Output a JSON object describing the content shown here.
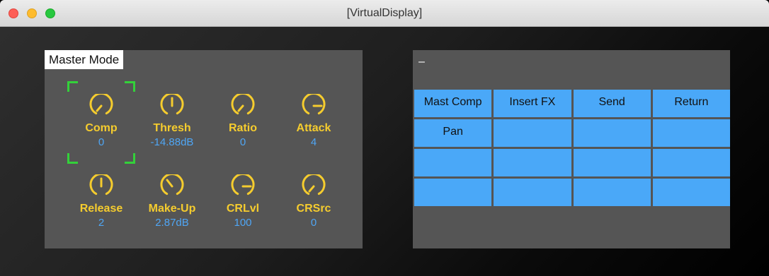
{
  "window": {
    "title": "[VirtualDisplay]"
  },
  "left_panel": {
    "title": "Master Mode",
    "knobs": [
      {
        "label": "Comp",
        "value": "0"
      },
      {
        "label": "Thresh",
        "value": "-14.88dB"
      },
      {
        "label": "Ratio",
        "value": "0"
      },
      {
        "label": "Attack",
        "value": "4"
      },
      {
        "label": "Release",
        "value": "2"
      },
      {
        "label": "Make-Up",
        "value": "2.87dB"
      },
      {
        "label": "CRLvl",
        "value": "100"
      },
      {
        "label": "CRSrc",
        "value": "0"
      }
    ]
  },
  "right_panel": {
    "header": "–",
    "grid": [
      [
        "Mast Comp",
        "Insert FX",
        "Send",
        "Return"
      ],
      [
        "Pan",
        "",
        "",
        ""
      ],
      [
        "",
        "",
        "",
        ""
      ],
      [
        "",
        "",
        "",
        ""
      ]
    ]
  },
  "colors": {
    "knob_label": "#f5cc2e",
    "knob_value": "#4fa6f5",
    "cell": "#4aa8f8",
    "focus": "#33d13a"
  }
}
